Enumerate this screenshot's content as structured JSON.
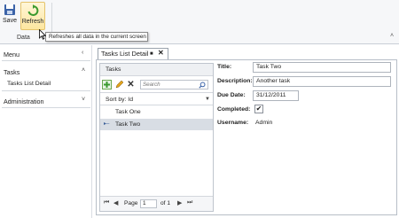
{
  "ribbon": {
    "save_label": "Save",
    "refresh_label": "Refresh",
    "group_label": "Data",
    "collapse_glyph": "˄"
  },
  "tooltip": {
    "text": "Refreshes all data in the current screen"
  },
  "nav": {
    "menu_label": "Menu",
    "menu_chevron": "‹",
    "tasks_label": "Tasks",
    "tasks_chevron": "˄",
    "tasks_item": "Tasks List Detail",
    "admin_label": "Administration",
    "admin_chevron": "˅"
  },
  "tab": {
    "label": "Tasks List Detail",
    "pin": "■",
    "close": "✕"
  },
  "tasks_panel": {
    "title": "Tasks",
    "search_placeholder": "Search",
    "sort_label": "Sort by: Id",
    "sort_chevron": "▼",
    "items": [
      {
        "label": "Task One"
      },
      {
        "label": "Task Two"
      }
    ],
    "selected_marker": "▸–",
    "pager": {
      "first": "⏮",
      "prev": "◀",
      "page_label": "Page",
      "page_value": "1",
      "of_label": "of 1",
      "next": "▶",
      "last": "⏭"
    }
  },
  "detail": {
    "title_label": "Title:",
    "title_value": "Task Two",
    "description_label": "Description:",
    "description_value": "Another task",
    "duedate_label": "Due Date:",
    "duedate_value": "31/12/2011",
    "completed_label": "Completed:",
    "completed_value": "✔",
    "username_label": "Username:",
    "username_value": "Admin"
  },
  "colors": {
    "accent_green": "#3a9a2e",
    "refresh_highlight": "#fde6a0",
    "selected_row": "#d8dde4"
  },
  "icons": [
    "save-icon",
    "refresh-icon",
    "add-icon",
    "edit-icon",
    "delete-icon",
    "search-icon"
  ]
}
